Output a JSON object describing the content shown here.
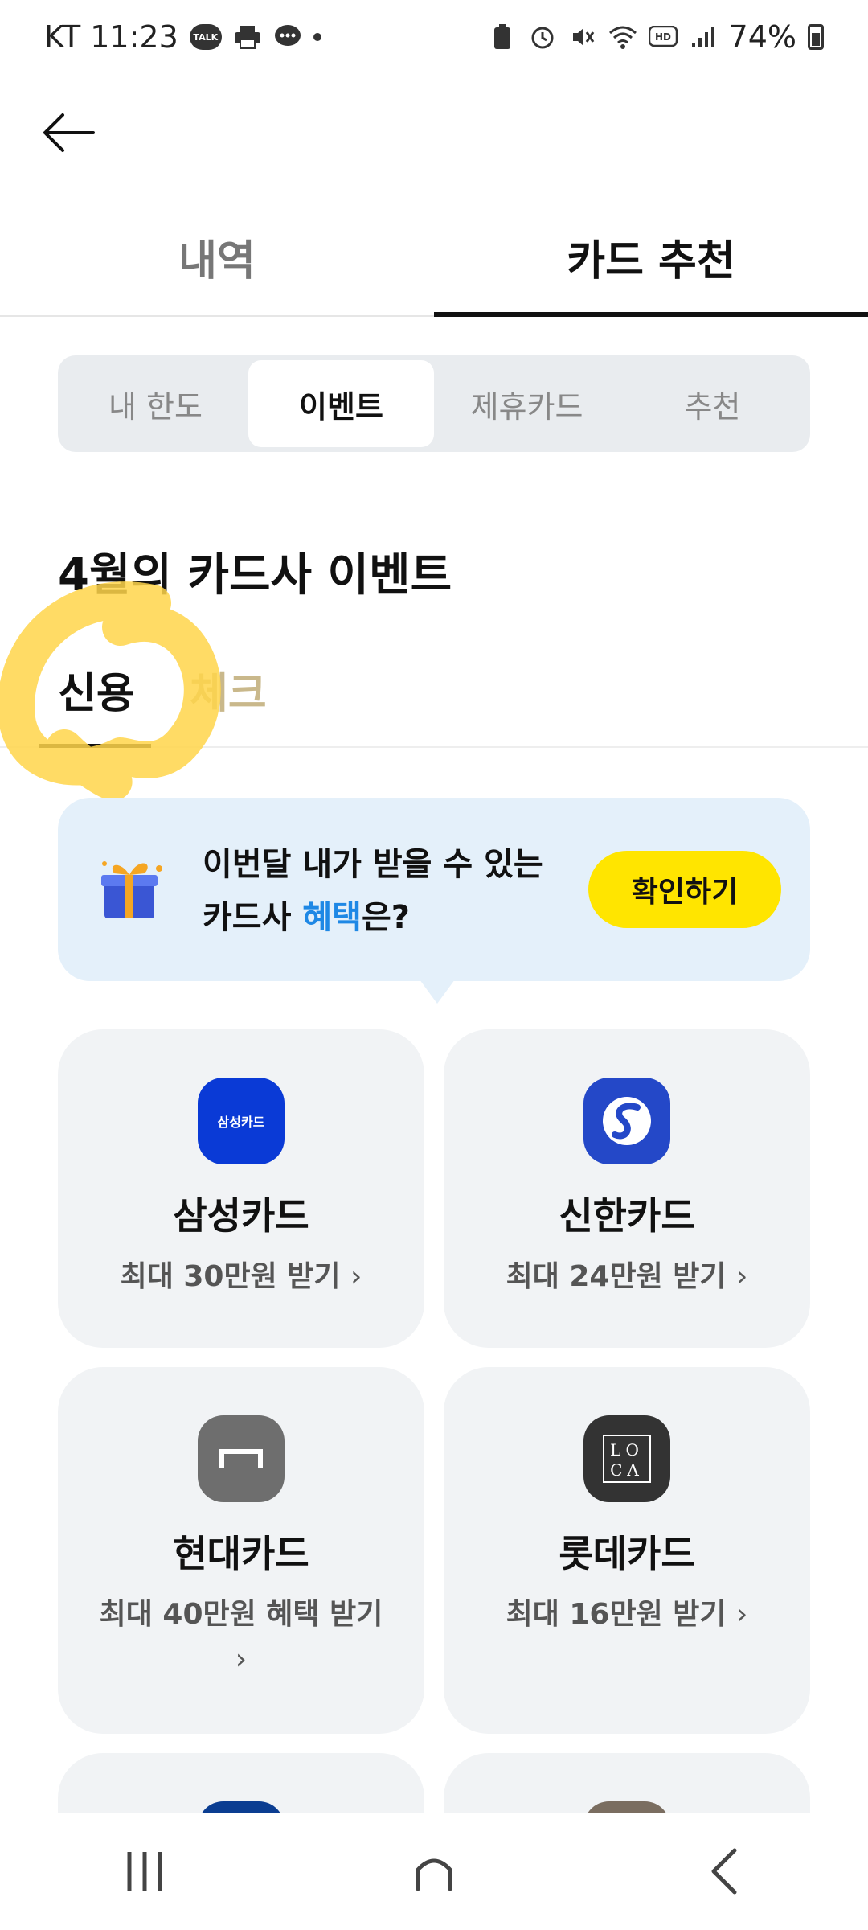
{
  "status_bar": {
    "carrier_time": "KT 11:23",
    "talk_label": "TALK",
    "battery": "74%"
  },
  "tabs": [
    {
      "label": "내역",
      "active": false
    },
    {
      "label": "카드 추천",
      "active": true
    }
  ],
  "segments": [
    {
      "label": "내 한도",
      "active": false
    },
    {
      "label": "이벤트",
      "active": true
    },
    {
      "label": "제휴카드",
      "active": false
    },
    {
      "label": "추천",
      "active": false
    }
  ],
  "section": {
    "title": "4월의 카드사 이벤트"
  },
  "sub_tabs": [
    {
      "label": "신용",
      "active": true
    },
    {
      "label": "체크",
      "active": false
    }
  ],
  "promo": {
    "line1": "이번달 내가 받을 수 있는",
    "line2_prefix": "카드사 ",
    "line2_highlight": "혜택",
    "line2_suffix": "은?",
    "button": "확인하기",
    "highlight_color": "#1e88e5",
    "button_color": "#ffe500"
  },
  "cards": [
    {
      "name": "삼성카드",
      "benefit": "최대 30만원 받기",
      "logo_text": "삼성카드",
      "logo_color": "#0a3ad6"
    },
    {
      "name": "신한카드",
      "benefit": "최대 24만원 받기",
      "logo_color": "#2448c8"
    },
    {
      "name": "현대카드",
      "benefit": "최대 40만원 혜택 받기",
      "logo_color": "#6e6e6e"
    },
    {
      "name": "롯데카드",
      "benefit": "최대 16만원 받기",
      "logo_text": "LOCA",
      "logo_color": "#333333"
    }
  ],
  "chevron": "›"
}
